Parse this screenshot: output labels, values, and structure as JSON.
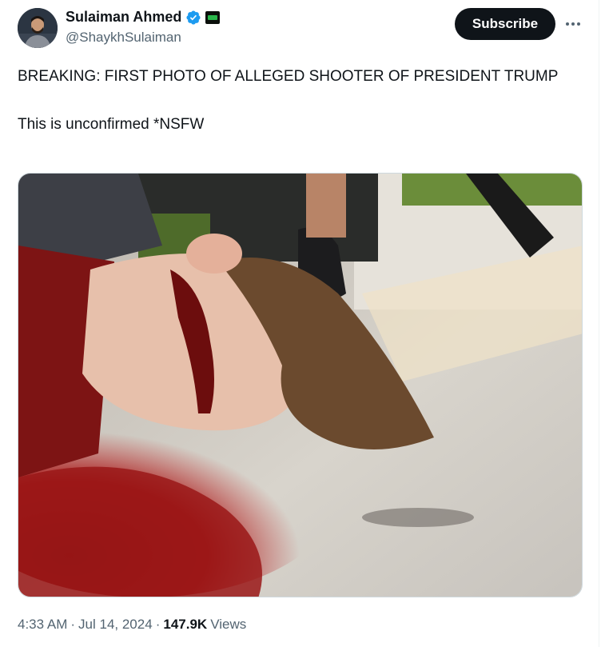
{
  "author": {
    "name": "Sulaiman Ahmed",
    "handle": "@ShaykhSulaiman",
    "verified": true,
    "affiliate_badge": "green-badge-icon"
  },
  "actions": {
    "subscribe_label": "Subscribe",
    "more_icon": "more-horizontal-icon"
  },
  "post": {
    "line1": "BREAKING: FIRST PHOTO OF ALLEGED SHOOTER OF PRESIDENT TRUMP",
    "line2": "This is unconfirmed *NSFW"
  },
  "media": {
    "type": "photo"
  },
  "meta": {
    "time": "4:33 AM",
    "separator": "·",
    "date": "Jul 14, 2024",
    "views_count": "147.9K",
    "views_label": "Views"
  },
  "colors": {
    "verified_blue": "#1d9bf0",
    "text_primary": "#0f1419",
    "text_secondary": "#536471",
    "button_dark": "#0f1419"
  }
}
